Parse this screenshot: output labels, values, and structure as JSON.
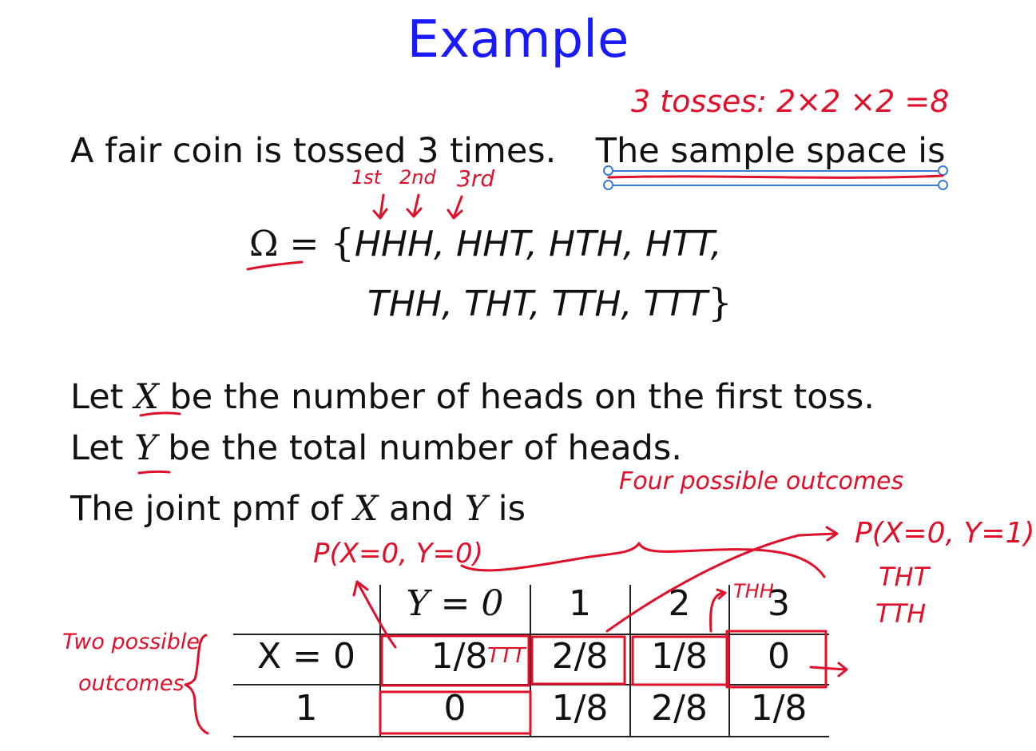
{
  "title": "Example",
  "intro": {
    "sentence_a": "A fair coin is tossed 3 times.",
    "sentence_b": "The sample space is"
  },
  "sample_space": {
    "omega": "Ω",
    "equals": "=",
    "open_brace": "{",
    "row1": "HHH, HHT, HTH, HTT,",
    "row2": "THH, THT, TTH, TTT",
    "close_brace": "}"
  },
  "definitions": {
    "line_x_pre": "Let",
    "line_x_var": "X",
    "line_x_post": "be the number of heads on the first toss.",
    "line_y_pre": "Let",
    "line_y_var": "Y",
    "line_y_post": "be the total number of heads.",
    "line_pmf_pre": "The joint pmf of",
    "line_pmf_x": "X",
    "line_pmf_and": "and",
    "line_pmf_y": "Y",
    "line_pmf_post": "is"
  },
  "pmf_table": {
    "col_headers": [
      "Y = 0",
      "1",
      "2",
      "3"
    ],
    "rows": [
      {
        "label": "X = 0",
        "values": [
          "1/8",
          "2/8",
          "1/8",
          "0"
        ]
      },
      {
        "label": "1",
        "values": [
          "0",
          "1/8",
          "2/8",
          "1/8"
        ]
      }
    ]
  },
  "annotations": {
    "tosses": "3  tosses:  2×2 ×2 =8",
    "toss_order": [
      "1st",
      "2nd",
      "3rd"
    ],
    "four_outcomes": "Four possible outcomes",
    "p_x0_y0": "P(X=0, Y=0)",
    "p_x0_y1": "P(X=0, Y=1)",
    "tht": "THT",
    "tth": "TTH",
    "ttt": "TTT",
    "thh": "THH",
    "two_outcomes_1": "Two possible",
    "two_outcomes_2": "outcomes"
  },
  "colors": {
    "title": "#1a1aff",
    "ink": "#e0102a",
    "selection": "#3a7bd5"
  }
}
